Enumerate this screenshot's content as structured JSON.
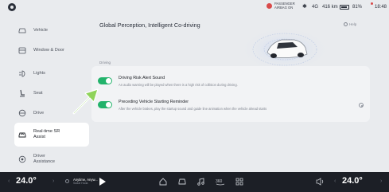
{
  "status_bar": {
    "airbag_text": "PASSENGER AIRBAG ON",
    "signal_text": "4G",
    "range": "416 km",
    "battery_percent": "81%",
    "battery_level": 0.81,
    "time": "18:48"
  },
  "sidebar": {
    "items": [
      {
        "label": "Vehicle",
        "icon": "car-outline-icon"
      },
      {
        "label": "Window & Door",
        "icon": "window-icon"
      },
      {
        "label": "Lights",
        "icon": "lights-icon"
      },
      {
        "label": "Seat",
        "icon": "seat-icon"
      },
      {
        "label": "Drive",
        "icon": "steering-wheel-icon"
      },
      {
        "label": "Real-time SR Assist",
        "icon": "sr-assist-icon",
        "active": true
      },
      {
        "label": "Driver Assistance",
        "icon": "driver-assist-icon"
      }
    ]
  },
  "main": {
    "title": "Global Perception, Intelligent Co-driving",
    "help_label": "Help",
    "section_label": "Driving",
    "settings": [
      {
        "title": "Driving Risk Alert Sound",
        "description": "An audio warning will be played when there is a high risk of collision during driving.",
        "enabled": true
      },
      {
        "title": "Preceding Vehicle Starting Reminder",
        "description": "After the vehicle brakes, play the startup sound and guide line animation when the vehicle ahead starts",
        "enabled": true
      }
    ]
  },
  "dock": {
    "left_temp": "24.0°",
    "right_temp": "24.0°",
    "media_title": "Anytime, Anyw...",
    "media_subtitle": "Sadaf Huda",
    "colors": {
      "accent": "#22b36b",
      "dock_bg": "#1c1f26",
      "arrow": "#8fd35a"
    }
  }
}
